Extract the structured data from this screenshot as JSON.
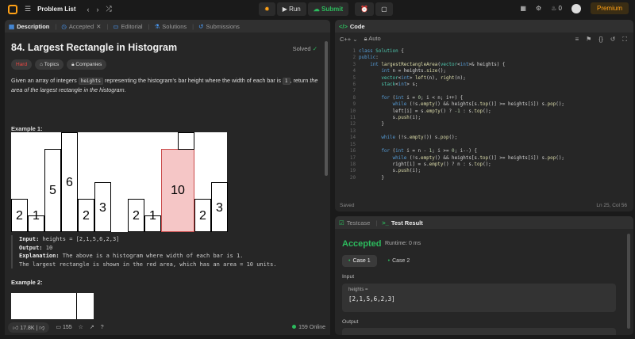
{
  "topbar": {
    "problem_list": "Problem List",
    "run": "Run",
    "submit": "Submit",
    "fire_count": "0",
    "premium": "Premium"
  },
  "left_tabs": [
    "Description",
    "Accepted",
    "Editorial",
    "Solutions",
    "Submissions"
  ],
  "problem": {
    "title": "84. Largest Rectangle in Histogram",
    "status": "Solved",
    "difficulty": "Hard",
    "topics": "Topics",
    "companies": "Companies",
    "desc_a": "Given an array of integers ",
    "desc_code1": "heights",
    "desc_b": " representing the histogram's bar height where the width of each bar is ",
    "desc_code2": "1",
    "desc_c": ", return ",
    "desc_d": "the area of the largest rectangle in the histogram",
    "desc_e": ".",
    "example1": "Example 1:",
    "example2": "Example 2:",
    "ex_input_label": "Input:",
    "ex_input": " heights = [2,1,5,6,2,3]",
    "ex_output_label": "Output:",
    "ex_output": " 10",
    "ex_expl_label": "Explanation:",
    "ex_expl1": " The above is a histogram where width of each bar is 1.",
    "ex_expl2": "The largest rectangle is shown in the red area, which has an area = 10 units."
  },
  "histogram": {
    "labels": [
      "2",
      "1",
      "5",
      "6",
      "2",
      "3",
      "2",
      "1",
      "10",
      "2",
      "3"
    ],
    "highlight_color": "#f5c6c6"
  },
  "bottom": {
    "likes": "17.8K",
    "comments": "155",
    "online": "159 Online"
  },
  "code": {
    "tab": "Code",
    "lang": "C++",
    "auto": "Auto",
    "saved": "Saved",
    "position": "Ln 25, Col 56"
  },
  "result": {
    "tab_testcase": "Testcase",
    "tab_result": "Test Result",
    "status": "Accepted",
    "runtime": "Runtime: 0 ms",
    "case1": "Case 1",
    "case2": "Case 2",
    "input_label": "Input",
    "param": "heights =",
    "value": "[2,1,5,6,2,3]",
    "output_label": "Output"
  }
}
